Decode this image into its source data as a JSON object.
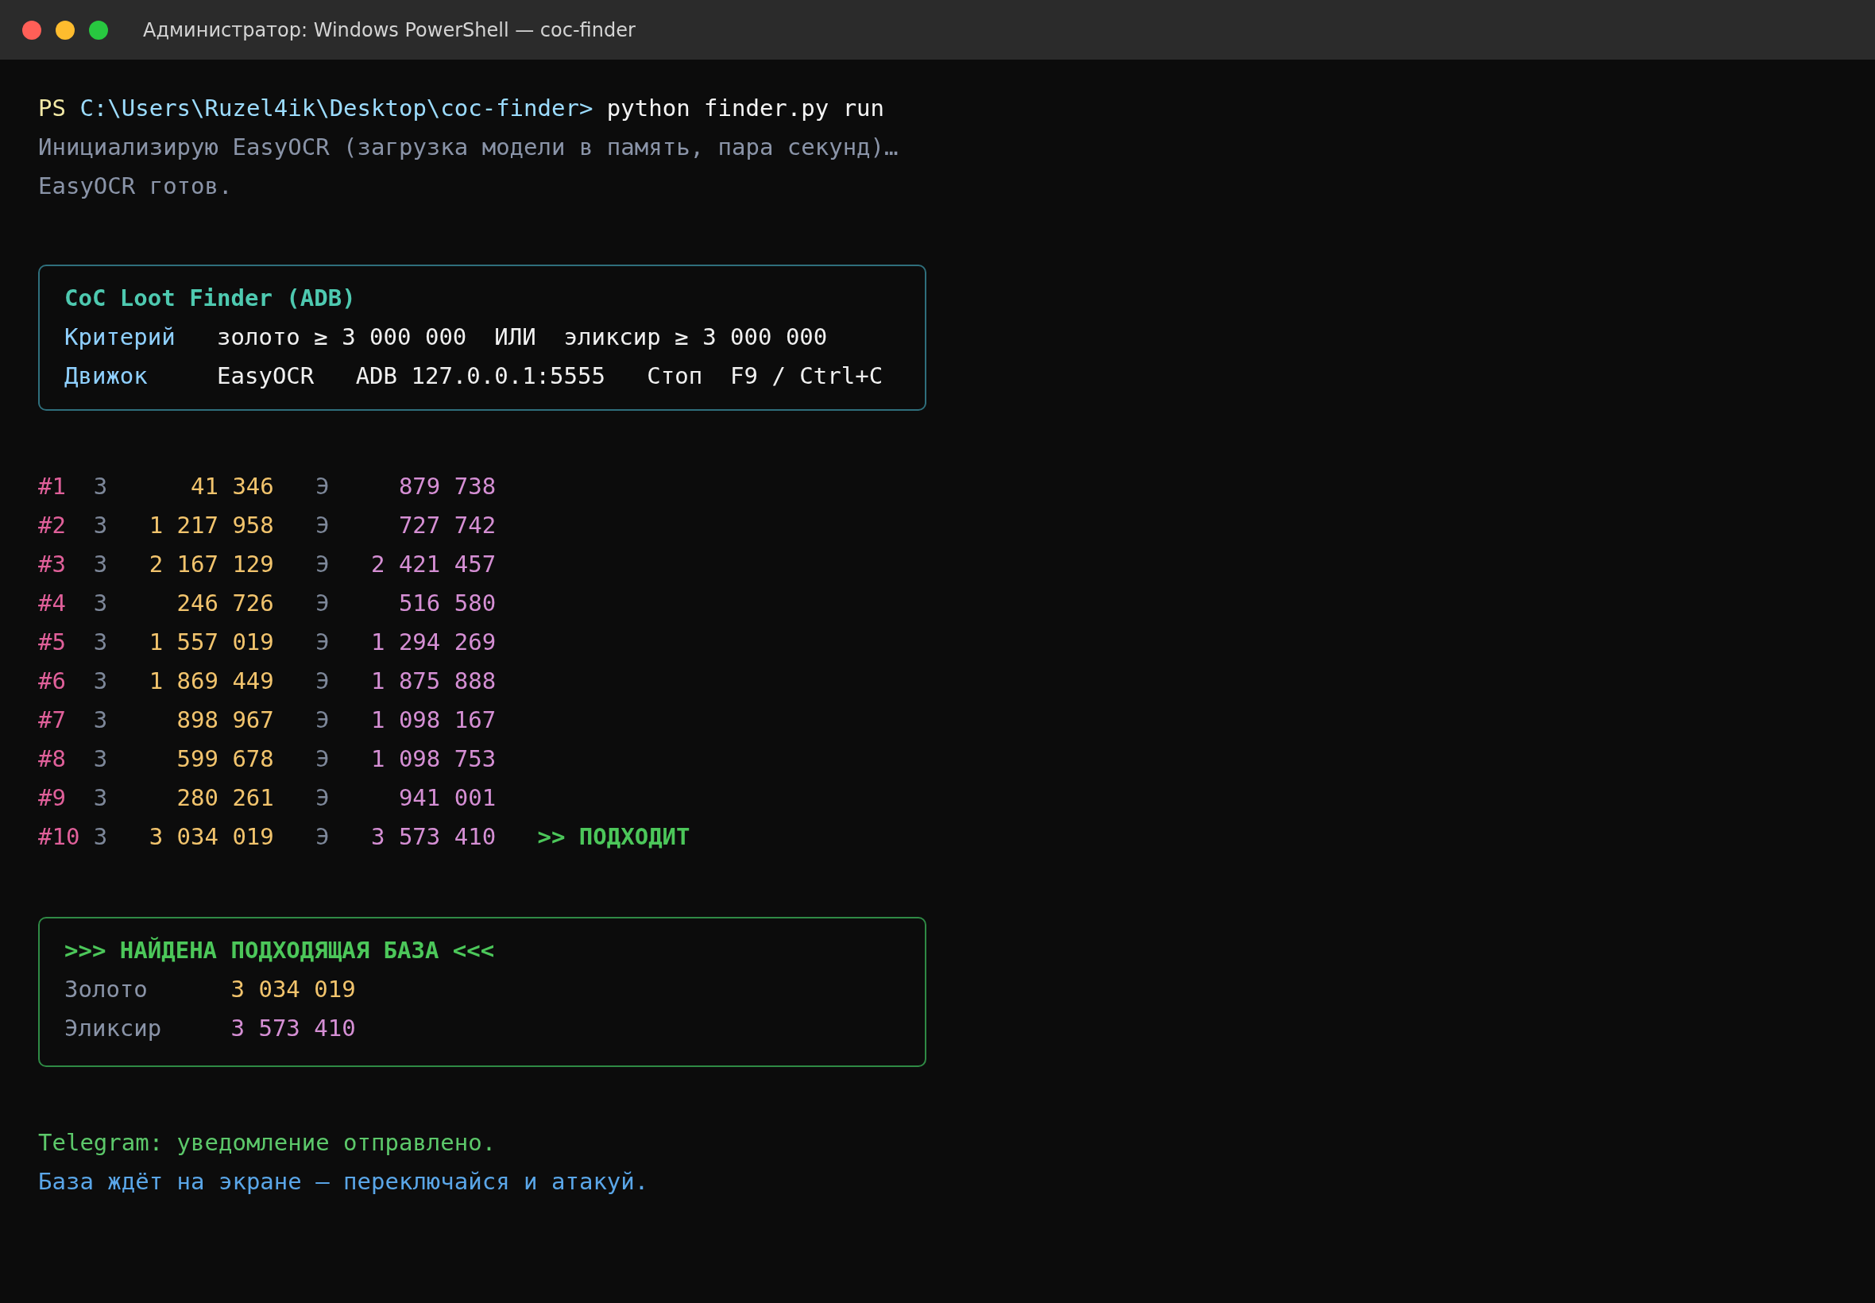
{
  "window": {
    "title": "Администратор: Windows PowerShell — coc-finder"
  },
  "prompt": {
    "prefix": "PS",
    "path": "C:\\Users\\Ruzel4ik\\Desktop\\coc-finder>",
    "command": "python finder.py run"
  },
  "init_lines": [
    {
      "kind": "muted",
      "text": "Инициализирую EasyOCR (загрузка модели в память, пара секунд)…"
    },
    {
      "kind": "muted",
      "text": "EasyOCR готов."
    }
  ],
  "info_box": {
    "title": "CoC Loot Finder (ADB)",
    "rows": [
      {
        "label": "Критерий",
        "value": "золото ≥ 3 000 000  ИЛИ  эликсир ≥ 3 000 000"
      },
      {
        "label": "Движок",
        "value": "EasyOCR   ADB 127.0.0.1:5555   Стоп  F9 / Ctrl+C"
      }
    ]
  },
  "scan_rows": [
    {
      "id": "#1",
      "gold_mark": "З",
      "gold": "41 346",
      "elixir_mark": "Э",
      "elixir": "879 738"
    },
    {
      "id": "#2",
      "gold_mark": "З",
      "gold": "1 217 958",
      "elixir_mark": "Э",
      "elixir": "727 742"
    },
    {
      "id": "#3",
      "gold_mark": "З",
      "gold": "2 167 129",
      "elixir_mark": "Э",
      "elixir": "2 421 457"
    },
    {
      "id": "#4",
      "gold_mark": "З",
      "gold": "246 726",
      "elixir_mark": "Э",
      "elixir": "516 580"
    },
    {
      "id": "#5",
      "gold_mark": "З",
      "gold": "1 557 019",
      "elixir_mark": "Э",
      "elixir": "1 294 269"
    },
    {
      "id": "#6",
      "gold_mark": "З",
      "gold": "1 869 449",
      "elixir_mark": "Э",
      "elixir": "1 875 888"
    },
    {
      "id": "#7",
      "gold_mark": "З",
      "gold": "898 967",
      "elixir_mark": "Э",
      "elixir": "1 098 167"
    },
    {
      "id": "#8",
      "gold_mark": "З",
      "gold": "599 678",
      "elixir_mark": "Э",
      "elixir": "1 098 753"
    },
    {
      "id": "#9",
      "gold_mark": "З",
      "gold": "280 261",
      "elixir_mark": "Э",
      "elixir": "941 001"
    },
    {
      "id": "#10",
      "gold_mark": "З",
      "gold": "3 034 019",
      "elixir_mark": "Э",
      "elixir": "3 573 410",
      "verdict": ">> ПОДХОДИТ"
    }
  ],
  "result_box": {
    "title": ">>> НАЙДЕНА ПОДХОДЯЩАЯ БАЗА <<<",
    "gold_label": "Золото",
    "gold": "3 034 019",
    "elixir_label": "Эликсир",
    "elixir": "3 573 410"
  },
  "notes": [
    {
      "kind": "success",
      "text": "Telegram: уведомление отправлено."
    },
    {
      "kind": "info",
      "text": "База ждёт на экране — переключайся и атакуй."
    }
  ]
}
